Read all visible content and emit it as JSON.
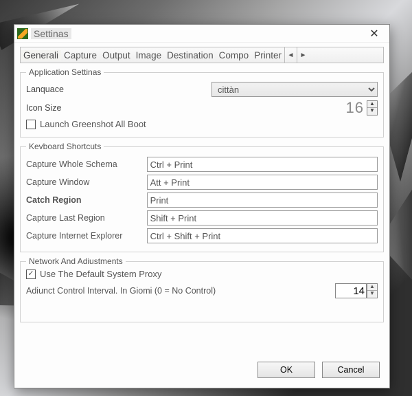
{
  "window": {
    "title": "Settinas"
  },
  "tabs": {
    "items": [
      "Generali",
      "Capture",
      "Output",
      "Image",
      "Destination",
      "Compo",
      "Printer"
    ],
    "active": 0
  },
  "app_settings": {
    "legend": "Application Settinas",
    "language_label": "Lanquace",
    "language_value": "cittàn",
    "icon_size_label": "Icon Size",
    "icon_size_value": "16",
    "launch_boot_label": "Launch Greenshot All Boot",
    "launch_boot_checked": false
  },
  "keyboard": {
    "legend": "Kevboard Shortcuts",
    "rows": [
      {
        "label": "Capture Whole Schema",
        "value": "Ctrl + Print"
      },
      {
        "label": "Capture Window",
        "value": "Att + Print"
      },
      {
        "label": "Catch Region",
        "value": "Print"
      },
      {
        "label": "Capture Last Region",
        "value": "Shift + Print"
      },
      {
        "label": "Capture Internet Explorer",
        "value": "Ctrl + Shift + Print"
      }
    ]
  },
  "network": {
    "legend": "Network And Adiustments",
    "proxy_label": "Use The Default System Proxy",
    "proxy_checked": true,
    "interval_label": "Adiunct Control Interval. In Giomi (0 = No Control)",
    "interval_value": "14"
  },
  "buttons": {
    "ok": "OK",
    "cancel": "Cancel"
  }
}
